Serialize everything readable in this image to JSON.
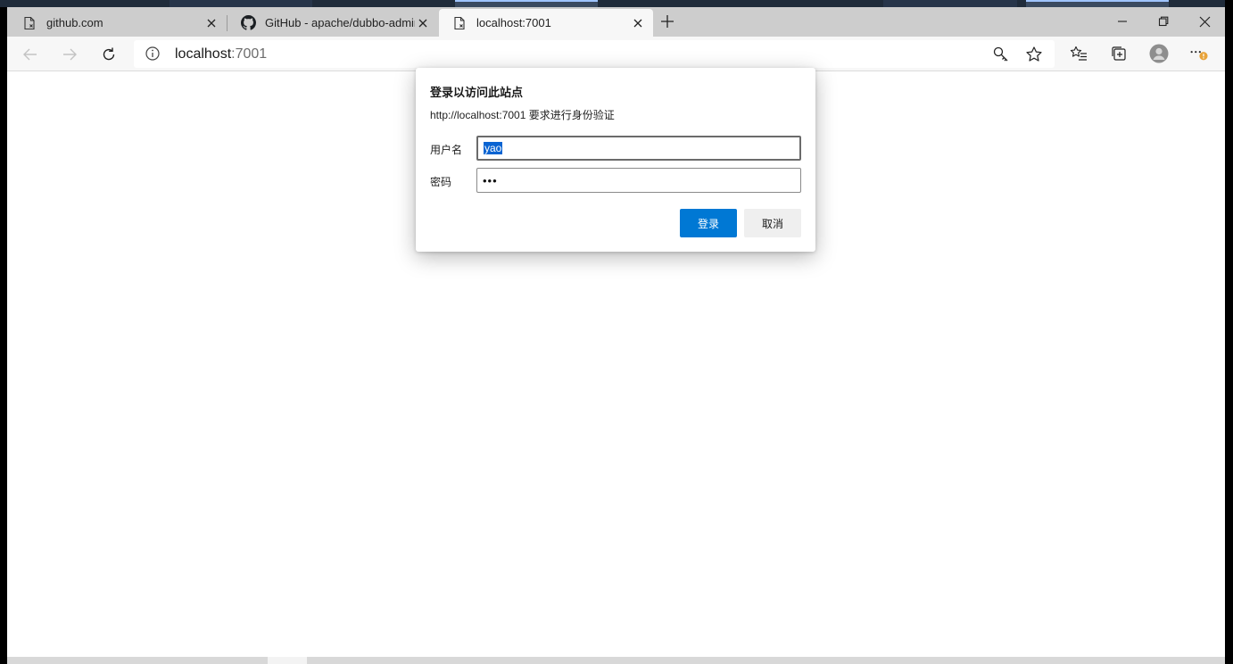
{
  "tabs": [
    {
      "title": "github.com",
      "icon": "page-error-icon",
      "active": false
    },
    {
      "title": "GitHub - apache/dubbo-admin: ",
      "icon": "github-icon",
      "active": false
    },
    {
      "title": "localhost:7001",
      "icon": "page-error-icon",
      "active": true
    }
  ],
  "window_controls": {
    "minimize": "minimize-icon",
    "restore": "restore-icon",
    "close": "close-icon"
  },
  "address_bar": {
    "host": "localhost",
    "port": ":7001"
  },
  "toolbar_icons": [
    "key-icon",
    "star-icon",
    "favorites-icon",
    "collections-icon",
    "profile-icon",
    "more-icon"
  ],
  "dialog": {
    "title": "登录以访问此站点",
    "description": "http://localhost:7001 要求进行身份验证",
    "username_label": "用户名",
    "username_value": "yao",
    "password_label": "密码",
    "password_value": "•••",
    "login_button": "登录",
    "cancel_button": "取消"
  },
  "colors": {
    "accent": "#0078d4",
    "selection": "#0a64d2",
    "tabbar": "#cdcdcd",
    "toolbar": "#f7f7f7",
    "notification": "#e8a33a"
  }
}
